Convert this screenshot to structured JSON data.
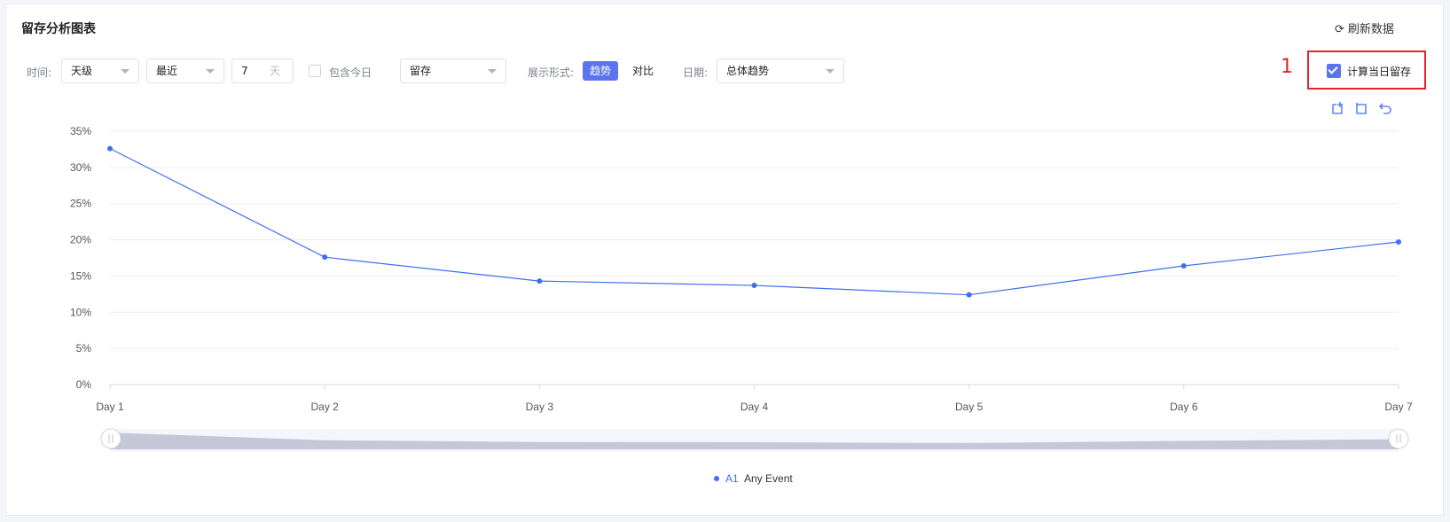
{
  "header": {
    "title": "留存分析图表",
    "refresh_label": "刷新数据"
  },
  "toolbar": {
    "time_label": "时间:",
    "granularity": "天级",
    "range_mode": "最近",
    "range_value": "7",
    "range_unit": "天",
    "include_today": "包含今日",
    "metric": "留存",
    "display_label": "展示形式:",
    "display_trend": "趋势",
    "display_compare": "对比",
    "date_label": "日期:",
    "date_value": "总体趋势",
    "calc_same_day": "计算当日留存",
    "annotation": "1"
  },
  "legend": {
    "series_id": "A1",
    "series_name": "Any Event"
  },
  "colors": {
    "accent": "#5b75f0",
    "line": "#3d6ff2",
    "highlight": "#e4232b"
  },
  "chart_data": {
    "type": "line",
    "categories": [
      "Day 1",
      "Day 2",
      "Day 3",
      "Day 4",
      "Day 5",
      "Day 6",
      "Day 7"
    ],
    "series": [
      {
        "name": "A1 Any Event",
        "values": [
          32.6,
          17.6,
          14.3,
          13.7,
          12.4,
          16.4,
          19.7
        ]
      }
    ],
    "ylim": [
      0,
      35
    ],
    "yticks": [
      "0%",
      "5%",
      "10%",
      "15%",
      "20%",
      "25%",
      "30%",
      "35%"
    ],
    "grid": true,
    "legend_position": "bottom"
  }
}
